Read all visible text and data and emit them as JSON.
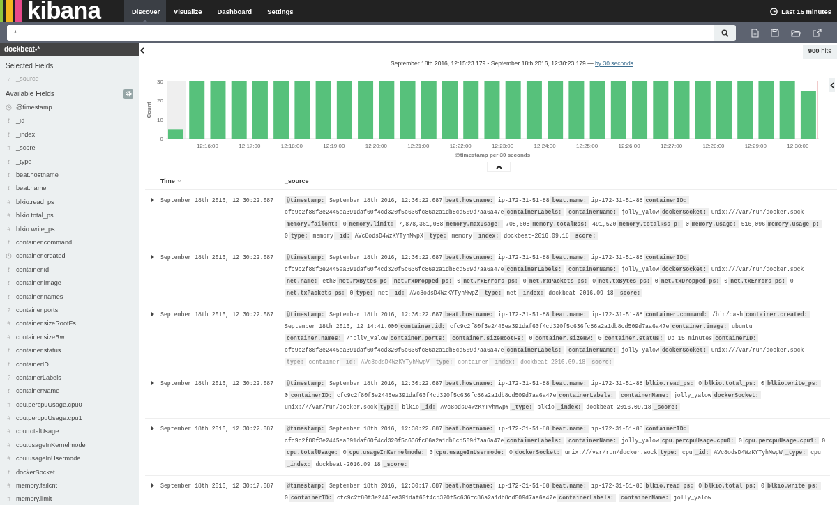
{
  "nav": {
    "logo": "kibana",
    "tabs": [
      {
        "label": "Discover",
        "selected": true
      },
      {
        "label": "Visualize",
        "selected": false
      },
      {
        "label": "Dashboard",
        "selected": false
      },
      {
        "label": "Settings",
        "selected": false
      }
    ],
    "timepicker": "Last 15 minutes"
  },
  "search": {
    "value": "*"
  },
  "sidebar": {
    "index_pattern": "dockbeat-*",
    "selected_title": "Selected Fields",
    "selected_fields": [
      {
        "kind": "glyph",
        "glyph": "?",
        "name": "_source",
        "muted": true
      }
    ],
    "available_title": "Available Fields",
    "available_fields": [
      {
        "kind": "date",
        "name": "@timestamp"
      },
      {
        "kind": "glyph",
        "glyph": "t",
        "name": "_id"
      },
      {
        "kind": "glyph",
        "glyph": "t",
        "name": "_index"
      },
      {
        "kind": "glyph",
        "glyph": "#",
        "name": "_score"
      },
      {
        "kind": "glyph",
        "glyph": "t",
        "name": "_type"
      },
      {
        "kind": "glyph",
        "glyph": "t",
        "name": "beat.hostname"
      },
      {
        "kind": "glyph",
        "glyph": "t",
        "name": "beat.name"
      },
      {
        "kind": "glyph",
        "glyph": "#",
        "name": "blkio.read_ps"
      },
      {
        "kind": "glyph",
        "glyph": "#",
        "name": "blkio.total_ps"
      },
      {
        "kind": "glyph",
        "glyph": "#",
        "name": "blkio.write_ps"
      },
      {
        "kind": "glyph",
        "glyph": "t",
        "name": "container.command"
      },
      {
        "kind": "date",
        "name": "container.created"
      },
      {
        "kind": "glyph",
        "glyph": "t",
        "name": "container.id"
      },
      {
        "kind": "glyph",
        "glyph": "t",
        "name": "container.image"
      },
      {
        "kind": "glyph",
        "glyph": "t",
        "name": "container.names"
      },
      {
        "kind": "glyph",
        "glyph": "?",
        "name": "container.ports"
      },
      {
        "kind": "glyph",
        "glyph": "#",
        "name": "container.sizeRootFs"
      },
      {
        "kind": "glyph",
        "glyph": "#",
        "name": "container.sizeRw"
      },
      {
        "kind": "glyph",
        "glyph": "t",
        "name": "container.status"
      },
      {
        "kind": "glyph",
        "glyph": "t",
        "name": "containerID"
      },
      {
        "kind": "glyph",
        "glyph": "?",
        "name": "containerLabels"
      },
      {
        "kind": "glyph",
        "glyph": "t",
        "name": "containerName"
      },
      {
        "kind": "glyph",
        "glyph": "#",
        "name": "cpu.percpuUsage.cpu0"
      },
      {
        "kind": "glyph",
        "glyph": "#",
        "name": "cpu.percpuUsage.cpu1"
      },
      {
        "kind": "glyph",
        "glyph": "#",
        "name": "cpu.totalUsage"
      },
      {
        "kind": "glyph",
        "glyph": "#",
        "name": "cpu.usageInKernelmode"
      },
      {
        "kind": "glyph",
        "glyph": "#",
        "name": "cpu.usageInUsermode"
      },
      {
        "kind": "glyph",
        "glyph": "t",
        "name": "dockerSocket"
      },
      {
        "kind": "glyph",
        "glyph": "#",
        "name": "memory.failcnt"
      },
      {
        "kind": "glyph",
        "glyph": "#",
        "name": "memory.limit"
      }
    ]
  },
  "hits": "**900** hits",
  "time_range": {
    "text": "September 18th 2016, 12:15:23.179 - September 18th 2016, 12:30:23.179 —",
    "link": "by 30 seconds"
  },
  "chart_data": {
    "type": "bar",
    "xlabel": "@timestamp per 30 seconds",
    "ylabel": "Count",
    "categories": [
      null,
      null,
      "12:16:00",
      null,
      "12:17:00",
      null,
      "12:18:00",
      null,
      "12:19:00",
      null,
      "12:20:00",
      null,
      "12:21:00",
      null,
      "12:22:00",
      null,
      "12:23:00",
      null,
      "12:24:00",
      null,
      "12:25:00",
      null,
      "12:26:00",
      null,
      "12:27:00",
      null,
      "12:28:00",
      null,
      "12:29:00",
      null,
      "12:30:00"
    ],
    "series": [
      {
        "color": "#57c17b",
        "values": [
          5,
          30,
          30,
          30,
          30,
          30,
          30,
          30,
          30,
          30,
          30,
          30,
          30,
          30,
          30,
          30,
          30,
          30,
          30,
          30,
          30,
          30,
          30,
          30,
          30,
          30,
          30,
          30,
          30,
          30,
          25
        ]
      }
    ],
    "ylim": [
      0,
      30
    ],
    "yticks": [
      0,
      10,
      20,
      30
    ]
  },
  "table": {
    "columns": [
      {
        "label": "Time",
        "sorted": true
      },
      {
        "label": "_source",
        "sorted": false
      }
    ],
    "rows": [
      {
        "time": "September 18th 2016, 12:30:22.087",
        "truncated": false,
        "fields": [
          {
            "key": "@timestamp:",
            "value": "September 18th 2016, 12:30:22.087"
          },
          {
            "key": "beat.hostname:",
            "value": "ip-172-31-51-88"
          },
          {
            "key": "beat.name:",
            "value": "ip-172-31-51-88"
          },
          {
            "key": "containerID:",
            "value": "cfc9c2f80f3e2445ea391daf60f4cd320f5c636fc86a2a1db8cd509d7aa6a47e"
          },
          {
            "key": "containerLabels:"
          },
          {
            "key": "containerName:",
            "value": "jolly_yalow"
          },
          {
            "key": "dockerSocket:",
            "value": "unix:///var/run/docker.sock"
          },
          {
            "key": "memory.failcnt:",
            "value": "0"
          },
          {
            "key": "memory.limit:",
            "value": "7,878,361,088"
          },
          {
            "key": "memory.maxUsage:",
            "value": "708,608"
          },
          {
            "key": "memory.totalRss:",
            "value": "491,520"
          },
          {
            "key": "memory.totalRss_p:",
            "value": "0"
          },
          {
            "key": "memory.usage:",
            "value": "516,096"
          },
          {
            "key": "memory.usage_p:",
            "value": "0"
          },
          {
            "key": "type:",
            "value": "memory"
          },
          {
            "key": "_id:",
            "value": "AVc8odsD4WzKYTyhMwpX"
          },
          {
            "key": "_type:",
            "value": "memory"
          },
          {
            "key": "_index:",
            "value": "dockbeat-2016.09.18"
          },
          {
            "key": "_score:"
          }
        ]
      },
      {
        "time": "September 18th 2016, 12:30:22.087",
        "truncated": false,
        "fields": [
          {
            "key": "@timestamp:",
            "value": "September 18th 2016, 12:30:22.087"
          },
          {
            "key": "beat.hostname:",
            "value": "ip-172-31-51-88"
          },
          {
            "key": "beat.name:",
            "value": "ip-172-31-51-88"
          },
          {
            "key": "containerID:",
            "value": "cfc9c2f80f3e2445ea391daf60f4cd320f5c636fc86a2a1db8cd509d7aa6a47e"
          },
          {
            "key": "containerLabels:"
          },
          {
            "key": "containerName:",
            "value": "jolly_yalow"
          },
          {
            "key": "dockerSocket:",
            "value": "unix:///var/run/docker.sock"
          },
          {
            "key": "net.name:",
            "value": "eth0"
          },
          {
            "key": "net.rxBytes_ps"
          },
          {
            "key": "net.rxDropped_ps:",
            "value": "0"
          },
          {
            "key": "net.rxErrors_ps:",
            "value": "0"
          },
          {
            "key": "net.rxPackets_ps:",
            "value": "0"
          },
          {
            "key": "net.txBytes_ps:",
            "value": "0"
          },
          {
            "key": "net.txDropped_ps:",
            "value": "0"
          },
          {
            "key": "net.txErrors_ps:",
            "value": "0"
          },
          {
            "key": "net.txPackets_ps:",
            "value": "0"
          },
          {
            "key": "type:",
            "value": "net"
          },
          {
            "key": "_id:",
            "value": "AVc8odsD4WzKYTyhMwpZ"
          },
          {
            "key": "_type:",
            "value": "net"
          },
          {
            "key": "_index:",
            "value": "dockbeat-2016.09.18"
          },
          {
            "key": "_score:"
          }
        ]
      },
      {
        "time": "September 18th 2016, 12:30:22.087",
        "truncated": true,
        "fields": [
          {
            "key": "@timestamp:",
            "value": "September 18th 2016, 12:30:22.087"
          },
          {
            "key": "beat.hostname:",
            "value": "ip-172-31-51-88"
          },
          {
            "key": "beat.name:",
            "value": "ip-172-31-51-88"
          },
          {
            "key": "container.command:",
            "value": "/bin/bash"
          },
          {
            "key": "container.created:",
            "value": "September 18th 2016, 12:14:41.000"
          },
          {
            "key": "container.id:",
            "value": "cfc9c2f80f3e2445ea391daf60f4cd320f5c636fc86a2a1db8cd509d7aa6a47e"
          },
          {
            "key": "container.image:",
            "value": "ubuntu"
          },
          {
            "key": "container.names:",
            "value": "/jolly_yalow"
          },
          {
            "key": "container.ports:"
          },
          {
            "key": "container.sizeRootFs:",
            "value": "0"
          },
          {
            "key": "container.sizeRw:",
            "value": "0"
          },
          {
            "key": "container.status:",
            "value": "Up 15 minutes"
          },
          {
            "key": "containerID:",
            "value": "cfc9c2f80f3e2445ea391daf60f4cd320f5c636fc86a2a1db8cd509d7aa6a47e"
          },
          {
            "key": "containerLabels:"
          },
          {
            "key": "containerName:",
            "value": "jolly_yalow"
          },
          {
            "key": "dockerSocket:",
            "value": "unix:///var/run/docker.sock"
          },
          {
            "key": "type:",
            "value": "container"
          },
          {
            "key": "_id:",
            "value": "AVc8odsD4WzKYTyhMwpV"
          },
          {
            "key": "_type:",
            "value": "container"
          },
          {
            "key": "_index:",
            "value": "dockbeat-2016.09.18"
          },
          {
            "key": "_score:"
          }
        ]
      },
      {
        "time": "September 18th 2016, 12:30:22.087",
        "truncated": false,
        "fields": [
          {
            "key": "@timestamp:",
            "value": "September 18th 2016, 12:30:22.087"
          },
          {
            "key": "beat.hostname:",
            "value": "ip-172-31-51-88"
          },
          {
            "key": "beat.name:",
            "value": "ip-172-31-51-88"
          },
          {
            "key": "blkio.read_ps:",
            "value": "0"
          },
          {
            "key": "blkio.total_ps:",
            "value": "0"
          },
          {
            "key": "blkio.write_ps:",
            "value": "0"
          },
          {
            "key": "containerID:",
            "value": "cfc9c2f80f3e2445ea391daf60f4cd320f5c636fc86a2a1db8cd509d7aa6a47e"
          },
          {
            "key": "containerLabels:"
          },
          {
            "key": "containerName:",
            "value": "jolly_yalow"
          },
          {
            "key": "dockerSocket:",
            "value": "unix:///var/run/docker.sock"
          },
          {
            "key": "type:",
            "value": "blkio"
          },
          {
            "key": "_id:",
            "value": "AVc8odsD4WzKYTyhMwpY"
          },
          {
            "key": "_type:",
            "value": "blkio"
          },
          {
            "key": "_index:",
            "value": "dockbeat-2016.09.18"
          },
          {
            "key": "_score:"
          }
        ]
      },
      {
        "time": "September 18th 2016, 12:30:22.087",
        "truncated": false,
        "fields": [
          {
            "key": "@timestamp:",
            "value": "September 18th 2016, 12:30:22.087"
          },
          {
            "key": "beat.hostname:",
            "value": "ip-172-31-51-88"
          },
          {
            "key": "beat.name:",
            "value": "ip-172-31-51-88"
          },
          {
            "key": "containerID:",
            "value": "cfc9c2f80f3e2445ea391daf60f4cd320f5c636fc86a2a1db8cd509d7aa6a47e"
          },
          {
            "key": "containerLabels:"
          },
          {
            "key": "containerName:",
            "value": "jolly_yalow"
          },
          {
            "key": "cpu.percpuUsage.cpu0:",
            "value": "0"
          },
          {
            "key": "cpu.percpuUsage.cpu1:",
            "value": "0"
          },
          {
            "key": "cpu.totalUsage:",
            "value": "0"
          },
          {
            "key": "cpu.usageInKernelmode:",
            "value": "0"
          },
          {
            "key": "cpu.usageInUsermode:",
            "value": "0"
          },
          {
            "key": "dockerSocket:",
            "value": "unix:///var/run/docker.sock"
          },
          {
            "key": "type:",
            "value": "cpu"
          },
          {
            "key": "_id:",
            "value": "AVc8odsD4WzKYTyhMwpW"
          },
          {
            "key": "_type:",
            "value": "cpu"
          },
          {
            "key": "_index:",
            "value": "dockbeat-2016.09.18"
          },
          {
            "key": "_score:"
          }
        ]
      },
      {
        "time": "September 18th 2016, 12:30:17.087",
        "truncated": false,
        "fields": [
          {
            "key": "@timestamp:",
            "value": "September 18th 2016, 12:30:17.087"
          },
          {
            "key": "beat.hostname:",
            "value": "ip-172-31-51-88"
          },
          {
            "key": "beat.name:",
            "value": "ip-172-31-51-88"
          },
          {
            "key": "blkio.read_ps:",
            "value": "0"
          },
          {
            "key": "blkio.total_ps:",
            "value": "0"
          },
          {
            "key": "blkio.write_ps:",
            "value": "0"
          },
          {
            "key": "containerID:",
            "value": "cfc9c2f80f3e2445ea391daf60f4cd320f5c636fc86a2a1db8cd509d7aa6a47e"
          },
          {
            "key": "containerLabels:"
          },
          {
            "key": "containerName:",
            "value": "jolly_yalow"
          }
        ]
      }
    ]
  }
}
